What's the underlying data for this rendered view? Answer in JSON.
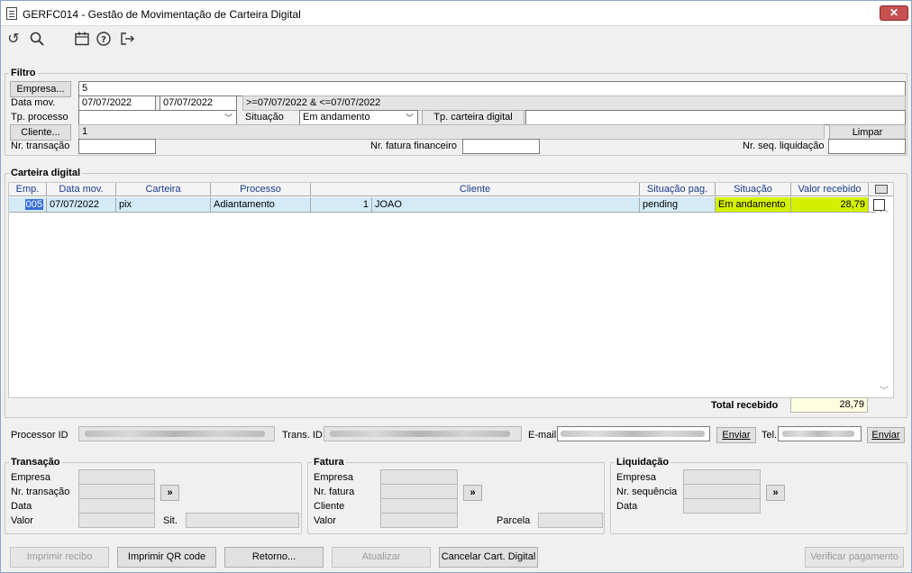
{
  "window": {
    "title": "GERFC014 - Gestão de Movimentação de Carteira Digital",
    "close": "✕"
  },
  "toolbar": {
    "icons": [
      "refresh-icon",
      "search-icon",
      "calendar-icon",
      "help-icon",
      "exit-icon"
    ],
    "refresh": "↺",
    "search": "⚲",
    "calendar": "▦",
    "help": "?",
    "exit": "⇥"
  },
  "filtro": {
    "legend": "Filtro",
    "empresa_button": "Empresa...",
    "empresa_value": "5",
    "data_mov_label": "Data mov.",
    "data_mov_from": "07/07/2022",
    "data_mov_to": "07/07/2022",
    "data_mov_expr": ">=07/07/2022 & <=07/07/2022",
    "tp_processo_label": "Tp. processo",
    "tp_processo_value": "",
    "situacao_label": "Situação",
    "situacao_value": "Em andamento",
    "tp_carteira_label": "Tp. carteira digital",
    "tp_carteira_value": "",
    "cliente_button": "Cliente...",
    "cliente_value": "1",
    "limpar_button": "Limpar",
    "nr_transacao_label": "Nr. transação",
    "nr_transacao_value": "",
    "nr_fatura_label": "Nr. fatura financeiro",
    "nr_fatura_value": "",
    "nr_seq_label": "Nr. seq. liquidação",
    "nr_seq_value": ""
  },
  "carteira": {
    "legend": "Carteira digital",
    "columns": [
      "Emp.",
      "Data mov.",
      "Carteira",
      "Processo",
      "Cliente",
      "Situação pag.",
      "Situação",
      "Valor recebido"
    ],
    "rows": [
      {
        "emp": "005",
        "data_mov": "07/07/2022",
        "carteira": "pix",
        "processo": "Adiantamento",
        "cliente_cod": "1",
        "cliente_nome": "JOAO",
        "situacao_pag": "pending",
        "situacao": "Em andamento",
        "valor": "28,79"
      }
    ],
    "total_label": "Total recebido",
    "total_value": "28,79"
  },
  "ids": {
    "processor_label": "Processor ID",
    "trans_label": "Trans. ID",
    "email_label": "E-mail",
    "enviar_email": "Enviar",
    "tel_label": "Tel.",
    "enviar_tel": "Enviar"
  },
  "transacao": {
    "legend": "Transação",
    "empresa": "Empresa",
    "nr_transacao": "Nr. transação",
    "data": "Data",
    "valor": "Valor",
    "sit": "Sit.",
    "go": "»"
  },
  "fatura": {
    "legend": "Fatura",
    "empresa": "Empresa",
    "nr_fatura": "Nr. fatura",
    "cliente": "Cliente",
    "valor": "Valor",
    "parcela": "Parcela",
    "go": "»"
  },
  "liquidacao": {
    "legend": "Liquidação",
    "empresa": "Empresa",
    "nr_sequencia": "Nr. sequência",
    "data": "Data",
    "go": "»"
  },
  "footer": {
    "imprimir_recibo": "Imprimir recibo",
    "imprimir_qr": "Imprimir QR code",
    "retorno": "Retorno...",
    "atualizar": "Atualizar",
    "cancelar": "Cancelar Cart. Digital",
    "verificar": "Verificar pagamento"
  },
  "colors": {
    "situacao_bg": "#d4f000",
    "row_bg": "#d4ebf7",
    "total_bg": "#fdfde0",
    "header_text": "#1a3a8a"
  }
}
